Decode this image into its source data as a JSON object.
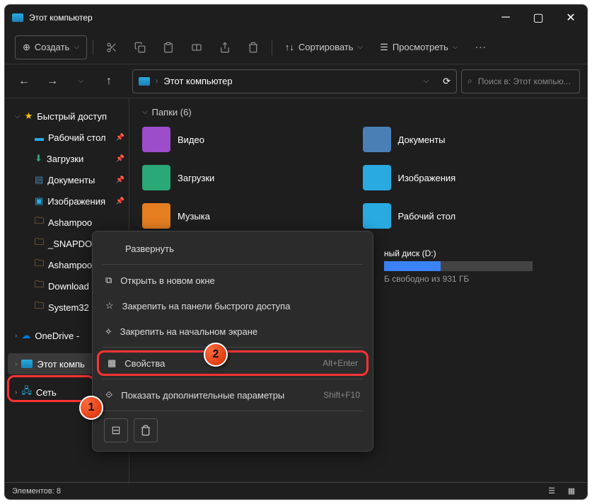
{
  "title": "Этот компьютер",
  "toolbar": {
    "create": "Создать",
    "sort": "Сортировать",
    "view": "Просмотреть"
  },
  "address": {
    "location": "Этот компьютер"
  },
  "search": {
    "placeholder": "Поиск в: Этот компью..."
  },
  "sidebar": {
    "quick_access": "Быстрый доступ",
    "items": [
      {
        "label": "Рабочий стол"
      },
      {
        "label": "Загрузки"
      },
      {
        "label": "Документы"
      },
      {
        "label": "Изображения"
      },
      {
        "label": "Ashampoo"
      },
      {
        "label": "_SNAPDO"
      },
      {
        "label": "Ashampoo"
      },
      {
        "label": "Download"
      },
      {
        "label": "System32"
      }
    ],
    "onedrive": "OneDrive -",
    "this_pc": "Этот компь",
    "network": "Сеть"
  },
  "content": {
    "section": "Папки (6)",
    "folders": [
      {
        "label": "Видео",
        "color": "#9b4dca"
      },
      {
        "label": "Документы",
        "color": "#4a7fb5"
      },
      {
        "label": "Загрузки",
        "color": "#2aa876"
      },
      {
        "label": "Изображения",
        "color": "#29abe2"
      },
      {
        "label": "Музыка",
        "color": "#e67e22"
      },
      {
        "label": "Рабочий стол",
        "color": "#29abe2"
      }
    ],
    "drive": {
      "label": "ный диск (D:)",
      "info": "Б свободно из 931 ГБ",
      "fill": 38
    }
  },
  "context": {
    "expand": "Развернуть",
    "open_new": "Открыть в новом окне",
    "pin_quick": "Закрепить на панели быстрого доступа",
    "pin_start": "Закрепить на начальном экране",
    "properties": "Свойства",
    "properties_shortcut": "Alt+Enter",
    "more_options": "Показать дополнительные параметры",
    "more_shortcut": "Shift+F10"
  },
  "status": {
    "items": "Элементов: 8"
  },
  "callouts": {
    "one": "1",
    "two": "2"
  }
}
